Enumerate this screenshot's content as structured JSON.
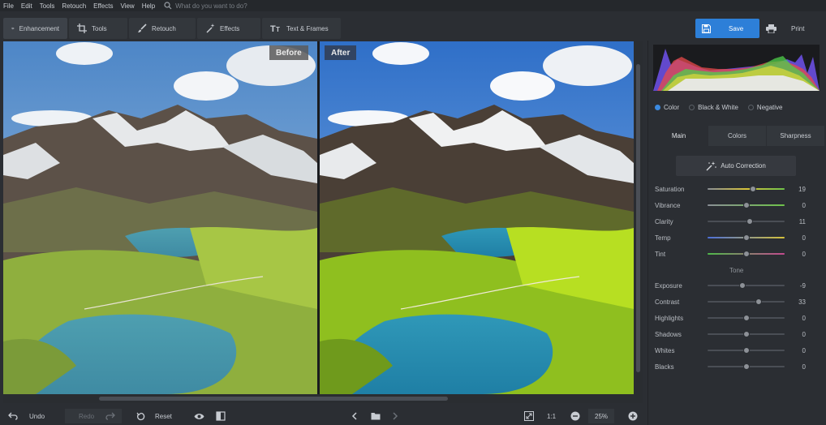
{
  "menu": {
    "items": [
      "File",
      "Edit",
      "Tools",
      "Retouch",
      "Effects",
      "View",
      "Help"
    ],
    "search_placeholder": "What do you want to do?"
  },
  "toolbar": {
    "tabs": [
      {
        "label": "Enhancement",
        "icon": "sliders-icon",
        "active": true
      },
      {
        "label": "Tools",
        "icon": "crop-icon",
        "active": false
      },
      {
        "label": "Retouch",
        "icon": "brush-icon",
        "active": false
      },
      {
        "label": "Effects",
        "icon": "magic-wand-icon",
        "active": false
      },
      {
        "label": "Text & Frames",
        "icon": "text-icon",
        "active": false
      }
    ],
    "save_label": "Save",
    "print_label": "Print"
  },
  "canvas": {
    "before_label": "Before",
    "after_label": "After"
  },
  "bottombar": {
    "undo_label": "Undo",
    "redo_label": "Redo",
    "reset_label": "Reset",
    "ratio_label": "1:1",
    "zoom_value": "25%"
  },
  "panel": {
    "modes": [
      {
        "label": "Color",
        "selected": true
      },
      {
        "label": "Black & White",
        "selected": false
      },
      {
        "label": "Negative",
        "selected": false
      }
    ],
    "sub_tabs": [
      {
        "label": "Main",
        "active": true
      },
      {
        "label": "Colors",
        "active": false
      },
      {
        "label": "Sharpness",
        "active": false
      }
    ],
    "auto_correction_label": "Auto Correction",
    "tone_label": "Tone",
    "sliders_main": [
      {
        "label": "Saturation",
        "value": "19",
        "level": 0.59
      },
      {
        "label": "Vibrance",
        "value": "0",
        "level": 0.5
      },
      {
        "label": "Clarity",
        "value": "11",
        "level": 0.55
      },
      {
        "label": "Temp",
        "value": "0",
        "level": 0.5
      },
      {
        "label": "Tint",
        "value": "0",
        "level": 0.5
      }
    ],
    "sliders_tone": [
      {
        "label": "Exposure",
        "value": "-9",
        "level": 0.45
      },
      {
        "label": "Contrast",
        "value": "33",
        "level": 0.66
      },
      {
        "label": "Highlights",
        "value": "0",
        "level": 0.5
      },
      {
        "label": "Shadows",
        "value": "0",
        "level": 0.5
      },
      {
        "label": "Whites",
        "value": "0",
        "level": 0.5
      },
      {
        "label": "Blacks",
        "value": "0",
        "level": 0.5
      }
    ],
    "colors": {
      "accent": "#2d7fd8",
      "saturation_track": [
        "#8a8f96",
        "#d6c23a",
        "#6fc34a"
      ],
      "vibrance_track": [
        "#8a8f96",
        "#6fc34a"
      ],
      "temp_track": [
        "#4c6fd8",
        "#d6c23a"
      ],
      "tint_track": [
        "#4fb84a",
        "#c34a8f"
      ]
    }
  }
}
